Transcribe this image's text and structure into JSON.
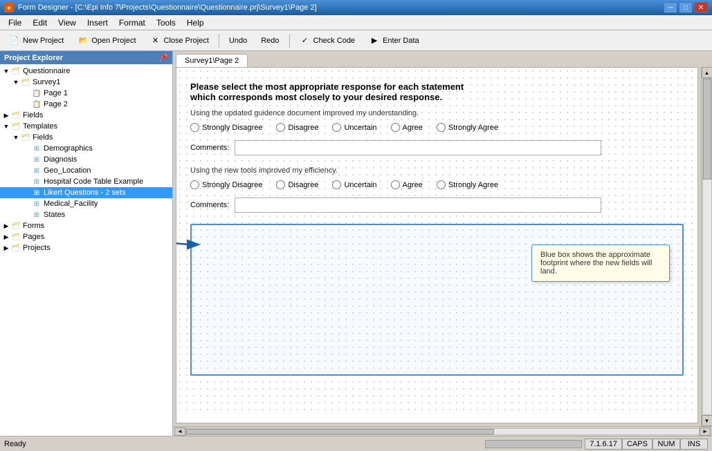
{
  "window": {
    "title": "Form Designer - [C:\\Epi Info 7\\Projects\\Questionnaire\\Questionnaire.prj\\Survey1\\Page 2]",
    "icon": "e"
  },
  "menu": {
    "items": [
      "File",
      "Edit",
      "View",
      "Insert",
      "Format",
      "Tools",
      "Help"
    ]
  },
  "toolbar": {
    "buttons": [
      {
        "label": "New Project",
        "icon": "📄"
      },
      {
        "label": "Open Project",
        "icon": "📂"
      },
      {
        "label": "Close Project",
        "icon": "✕"
      },
      {
        "label": "Undo",
        "icon": "↩"
      },
      {
        "label": "Redo",
        "icon": "↪"
      },
      {
        "label": "Check Code",
        "icon": "✓"
      },
      {
        "label": "Enter Data",
        "icon": "▶"
      }
    ]
  },
  "explorer": {
    "title": "Project Explorer",
    "pin_icon": "📌",
    "tree": [
      {
        "id": "questionnaire",
        "label": "Questionnaire",
        "level": 0,
        "type": "folder",
        "expanded": true
      },
      {
        "id": "survey1",
        "label": "Survey1",
        "level": 1,
        "type": "folder",
        "expanded": true
      },
      {
        "id": "page1",
        "label": "Page 1",
        "level": 2,
        "type": "page"
      },
      {
        "id": "page2",
        "label": "Page 2",
        "level": 2,
        "type": "page"
      },
      {
        "id": "fields",
        "label": "Fields",
        "level": 0,
        "type": "folder"
      },
      {
        "id": "templates",
        "label": "Templates",
        "level": 0,
        "type": "folder",
        "expanded": true
      },
      {
        "id": "fields2",
        "label": "Fields",
        "level": 1,
        "type": "folder",
        "expanded": true
      },
      {
        "id": "demographics",
        "label": "Demographics",
        "level": 2,
        "type": "table"
      },
      {
        "id": "diagnosis",
        "label": "Diagnosis",
        "level": 2,
        "type": "table"
      },
      {
        "id": "geo_location",
        "label": "Geo_Location",
        "level": 2,
        "type": "table"
      },
      {
        "id": "hospital",
        "label": "Hospital Code Table Example",
        "level": 2,
        "type": "table"
      },
      {
        "id": "likert",
        "label": "Likert Questions - 2 sets",
        "level": 2,
        "type": "table",
        "selected": true
      },
      {
        "id": "medical",
        "label": "Medical_Facility",
        "level": 2,
        "type": "table"
      },
      {
        "id": "states",
        "label": "States",
        "level": 2,
        "type": "table"
      },
      {
        "id": "forms",
        "label": "Forms",
        "level": 0,
        "type": "folder"
      },
      {
        "id": "pages",
        "label": "Pages",
        "level": 0,
        "type": "folder"
      },
      {
        "id": "projects",
        "label": "Projects",
        "level": 0,
        "type": "folder"
      }
    ]
  },
  "tab": {
    "label": "Survey1\\Page 2"
  },
  "form": {
    "title_line1": "Please select the most appropriate response for each statement",
    "title_line2": "which corresponds most closely to your desired response.",
    "question1": {
      "label": "Using the updated guidence document improved my understanding.",
      "options": [
        "Strongly Disagree",
        "Disagree",
        "Uncertain",
        "Agree",
        "Strongly Agree"
      ],
      "comment_label": "Comments:"
    },
    "question2": {
      "label": "Using the new tools improved my efficiency.",
      "options": [
        "Strongly Disagree",
        "Disagree",
        "Uncertain",
        "Agree",
        "Strongly Agree"
      ],
      "comment_label": "Comments:"
    },
    "tooltip": "Blue box shows the approximate footprint where the new fields will land."
  },
  "status": {
    "ready": "Ready",
    "version": "7.1.6.17",
    "caps": "CAPS",
    "num": "NUM",
    "ins": "INS"
  }
}
